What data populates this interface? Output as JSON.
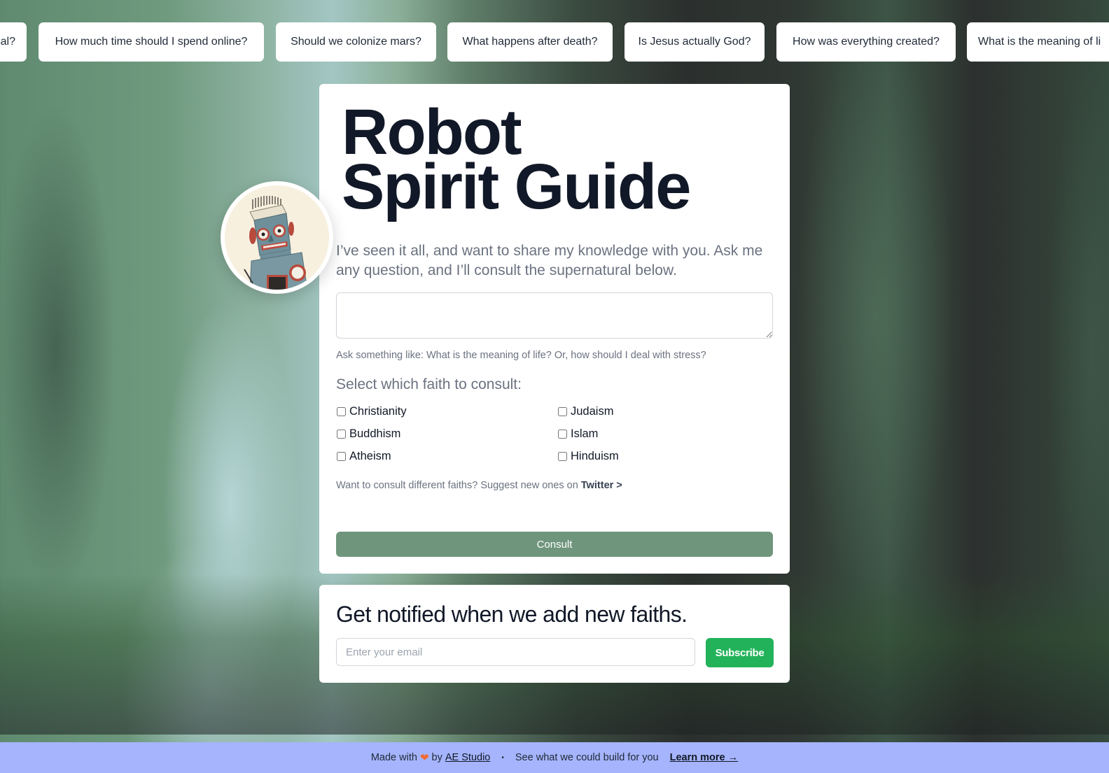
{
  "suggestions": [
    "What is the meaning of life? How should I deal?",
    "How much time should I spend online?",
    "Should we colonize mars?",
    "What happens after death?",
    "Is Jesus actually God?",
    "How was everything created?",
    "What is the meaning of life?"
  ],
  "suggestions_visible": [
    "al?",
    "How much time should I spend online?",
    "Should we colonize mars?",
    "What happens after death?",
    "Is Jesus actually God?",
    "How was everything created?",
    "What is the meaning of li"
  ],
  "main": {
    "title_line1": "Robot",
    "title_line2": "Spirit Guide",
    "avatar_alt": "Vintage tin toy robot",
    "intro": "I’ve seen it all, and want to share my knowledge with you. Ask me any question, and I’ll consult the supernatural below.",
    "question_value": "",
    "hint": "Ask something like: What is the meaning of life? Or, how should I deal with stress?",
    "faith_label": "Select which faith to consult:",
    "faiths": [
      {
        "label": "Christianity",
        "checked": false
      },
      {
        "label": "Judaism",
        "checked": false
      },
      {
        "label": "Buddhism",
        "checked": false
      },
      {
        "label": "Islam",
        "checked": false
      },
      {
        "label": "Atheism",
        "checked": false
      },
      {
        "label": "Hinduism",
        "checked": false
      }
    ],
    "suggest_text": "Want to consult different faiths? Suggest new ones on ",
    "suggest_link": "Twitter >",
    "consult_label": "Consult"
  },
  "notify": {
    "title": "Get notified when we add new faiths.",
    "email_placeholder": "Enter your email",
    "email_value": "",
    "subscribe_label": "Subscribe"
  },
  "footer": {
    "made_with": "Made with",
    "heart_icon": "heart-icon",
    "by": "by",
    "studio_link": "AE Studio",
    "separator": "•",
    "pitch": "See what we could build for you",
    "learn_more": "Learn more →"
  },
  "colors": {
    "consult_button": "#6f967c",
    "subscribe_button": "#22b35a",
    "footer_bg": "#a5b4fc",
    "title_text": "#111827",
    "muted_text": "#6b7280",
    "heart": "#f26a2e"
  }
}
